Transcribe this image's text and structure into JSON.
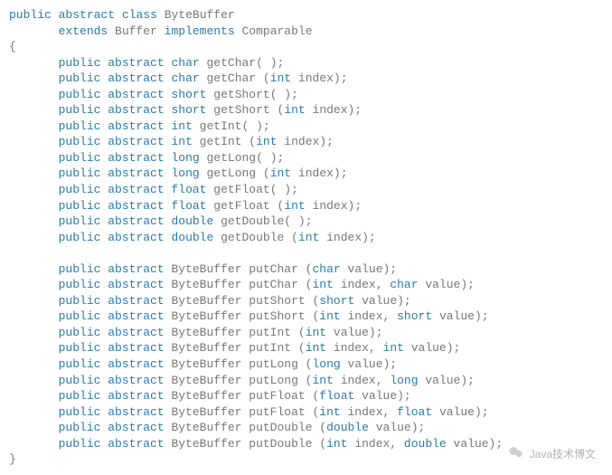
{
  "code": {
    "decl_kw1": "public",
    "decl_kw2": "abstract",
    "decl_kw3": "class",
    "decl_name": "ByteBuffer",
    "ext_kw1": "extends",
    "ext_name": "Buffer",
    "ext_kw2": "implements",
    "ext_iface": "Comparable",
    "brace_open": "{",
    "brace_close": "}",
    "lines": [
      "public abstract char getChar( );",
      "public abstract char getChar (int index);",
      "public abstract short getShort( );",
      "public abstract short getShort (int index);",
      "public abstract int getInt( );",
      "public abstract int getInt (int index);",
      "public abstract long getLong( );",
      "public abstract long getLong (int index);",
      "public abstract float getFloat( );",
      "public abstract float getFloat (int index);",
      "public abstract double getDouble( );",
      "public abstract double getDouble (int index);",
      "",
      "public abstract ByteBuffer putChar (char value);",
      "public abstract ByteBuffer putChar (int index, char value);",
      "public abstract ByteBuffer putShort (short value);",
      "public abstract ByteBuffer putShort (int index, short value);",
      "public abstract ByteBuffer putInt (int value);",
      "public abstract ByteBuffer putInt (int index, int value);",
      "public abstract ByteBuffer putLong (long value);",
      "public abstract ByteBuffer putLong (int index, long value);",
      "public abstract ByteBuffer putFloat (float value);",
      "public abstract ByteBuffer putFloat (int index, float value);",
      "public abstract ByteBuffer putDouble (double value);",
      "public abstract ByteBuffer putDouble (int index, double value);"
    ]
  },
  "watermark": {
    "text": "Java技术博文"
  }
}
